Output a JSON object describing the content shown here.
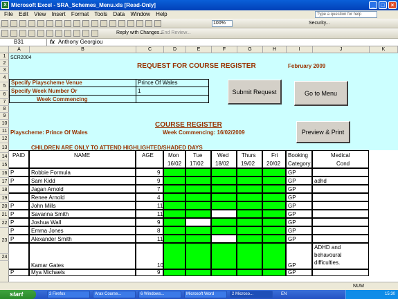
{
  "window": {
    "title": "Microsoft Excel - SRA_Schemes_Menu.xls  [Read-Only]",
    "help_placeholder": "Type a question for help"
  },
  "menu": [
    "File",
    "Edit",
    "View",
    "Insert",
    "Format",
    "Tools",
    "Data",
    "Window",
    "Help"
  ],
  "toolbar": {
    "zoom": "100%",
    "security": "Security...",
    "reply": "Reply with Changes...",
    "end_review": "End Review..."
  },
  "formula": {
    "cell": "B31",
    "fx": "fx",
    "value": "Anthony Georgiou"
  },
  "columns": [
    "A",
    "B",
    "C",
    "D",
    "E",
    "F",
    "G",
    "H",
    "I",
    "J",
    "K"
  ],
  "rows": [
    "1",
    "2",
    "3",
    "4",
    "5",
    "6",
    "7",
    "8",
    "9",
    "10",
    "11",
    "12",
    "13",
    "14",
    "15",
    "16",
    "17",
    "18",
    "19",
    "20",
    "21",
    "22",
    "23",
    "24"
  ],
  "top": {
    "code": "SCR2004",
    "heading": "REQUEST FOR COURSE REGISTER",
    "month": "February 2009",
    "venue_label": "Specify Playscheme Venue",
    "venue_value": "Prince Of Wales",
    "week_label": "Specify Week Number Or",
    "week_value": "1",
    "commencing_label": "Week Commencing",
    "submit": "Submit Request",
    "goto": "Go to Menu"
  },
  "register": {
    "title": "COURSE REGISTER",
    "playscheme": "Playscheme: Prince Of Wales",
    "commencing": "Week Commencing: 16/02/2009",
    "preview": "Preview & Print",
    "notice": "CHILDREN ARE ONLY TO ATTEND HIGHLIGHTED/SHADED  DAYS",
    "headers": {
      "paid": "PAID",
      "name": "NAME",
      "age": "AGE",
      "mon": "Mon",
      "tue": "Tue",
      "wed": "Wed",
      "thu": "Thurs",
      "fri": "Fri",
      "booking1": "Booking",
      "booking2": "Category",
      "medical1": "Medical",
      "medical2": "Cond"
    },
    "dates": [
      "16/02",
      "17/02",
      "18/02",
      "19/02",
      "20/02"
    ]
  },
  "children": [
    {
      "paid": "P",
      "name": "Robbie Formula",
      "age": "9",
      "days": [
        1,
        1,
        1,
        1,
        1
      ],
      "cat": "GP",
      "med": ""
    },
    {
      "paid": "P",
      "name": "Sam Kidd",
      "age": "9",
      "days": [
        1,
        1,
        1,
        1,
        1
      ],
      "cat": "GP",
      "med": "adhd"
    },
    {
      "paid": "",
      "name": "Jagan Arnold",
      "age": "7",
      "days": [
        1,
        1,
        1,
        1,
        1
      ],
      "cat": "GP",
      "med": ""
    },
    {
      "paid": "",
      "name": "Renee Arnold",
      "age": "4",
      "days": [
        1,
        1,
        1,
        1,
        1
      ],
      "cat": "GP",
      "med": ""
    },
    {
      "paid": "P",
      "name": "John Mills",
      "age": "11",
      "days": [
        1,
        1,
        1,
        1,
        1
      ],
      "cat": "GP",
      "med": ""
    },
    {
      "paid": "P",
      "name": "Savanna Smith",
      "age": "11",
      "days": [
        1,
        1,
        0,
        1,
        1
      ],
      "cat": "GP",
      "med": ""
    },
    {
      "paid": "P",
      "name": "Joshua Wall",
      "age": "9",
      "days": [
        1,
        0,
        1,
        1,
        1
      ],
      "cat": "GP",
      "med": ""
    },
    {
      "paid": "P",
      "name": "Emma Jones",
      "age": "8",
      "days": [
        1,
        1,
        1,
        1,
        1
      ],
      "cat": "GP",
      "med": ""
    },
    {
      "paid": "P",
      "name": "Alexander Smith",
      "age": "11",
      "days": [
        1,
        1,
        0,
        1,
        1
      ],
      "cat": "GP",
      "med": ""
    },
    {
      "paid": "",
      "name": "Kamar Gates",
      "age": "10",
      "days": [
        1,
        1,
        1,
        1,
        1
      ],
      "cat": "GP",
      "med": "ADHD and behavoural difficulties."
    },
    {
      "paid": "P",
      "name": "Mya Michaels",
      "age": "9",
      "days": [
        1,
        1,
        1,
        1,
        1
      ],
      "cat": "GP",
      "med": ""
    }
  ],
  "status": {
    "num": "NUM"
  },
  "taskbar": {
    "start": "start",
    "tasks": [
      "2 Firefox",
      "Arax Course...",
      "6 Windows...",
      "Microsoft Word",
      "2 Microso..."
    ],
    "lang": "EN",
    "clock": "15:30"
  }
}
